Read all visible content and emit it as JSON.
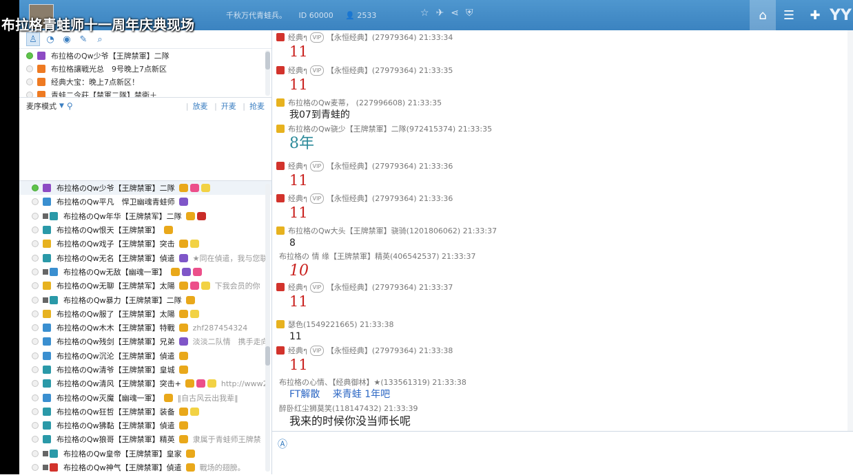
{
  "overlay_title": "布拉格青蛙师十一周年庆典现场",
  "header": {
    "slogan": "千秋万代青蛙兵。",
    "room_id": "ID 60000",
    "online_count": "2533",
    "icons": [
      "star-icon",
      "plane-icon",
      "share-icon",
      "shield-icon"
    ],
    "right_buttons": [
      "home-icon",
      "list-icon",
      "gamepad-icon"
    ],
    "brand": "YY"
  },
  "left_tabs": [
    "user-icon",
    "chat-bubble-icon",
    "location-icon",
    "edit-icon",
    "search-icon"
  ],
  "notices": [
    {
      "online": true,
      "gift": "purple",
      "text": "布拉格のQw少爷【王牌禁軍】二隊"
    },
    {
      "online": false,
      "gift": "orange",
      "text": "布拉格讓戦光总　9号晚上7点新区"
    },
    {
      "online": false,
      "gift": "orange",
      "text": "经典大宝：晚上7点新区！"
    },
    {
      "online": false,
      "gift": "orange",
      "text": "青蛙二今莊【禁軍二隊】禁衛＋"
    }
  ],
  "mic": {
    "mode_label": "麦序模式",
    "links": [
      "放麦",
      "开麦",
      "抢麦"
    ]
  },
  "users": [
    {
      "online": true,
      "cam": false,
      "name": "布拉格のQw少爷【王牌禁軍】二隊",
      "badges": [
        "crown",
        "pink",
        "yellow"
      ],
      "sig": ""
    },
    {
      "online": false,
      "cam": false,
      "name": "布拉格のQw平凡　悍卫幽魂青蛙师",
      "badges": [
        "purple"
      ],
      "sig": ""
    },
    {
      "online": false,
      "cam": true,
      "name": "布拉格のQw年华【王牌禁军】二隊",
      "badges": [
        "crown",
        "red"
      ],
      "sig": ""
    },
    {
      "online": false,
      "cam": false,
      "name": "布拉格のQw恨天【王牌禁軍】",
      "badges": [
        "crown"
      ],
      "sig": ""
    },
    {
      "online": false,
      "cam": false,
      "name": "布拉格のQw戏子【王牌禁軍】突击",
      "badges": [
        "crown",
        "yellow"
      ],
      "sig": ""
    },
    {
      "online": false,
      "cam": false,
      "name": "布拉格のQw无名【王牌禁軍】偵遣",
      "badges": [
        "purple"
      ],
      "sig": "★同在偵遣，我与您联"
    },
    {
      "online": false,
      "cam": true,
      "name": "布拉格のQw无敌【幽魂一軍】",
      "badges": [
        "crown",
        "purple",
        "pink"
      ],
      "sig": ""
    },
    {
      "online": false,
      "cam": false,
      "name": "布拉格のQw无聊【王牌禁军】太陽",
      "badges": [
        "crown",
        "pink",
        "yellow"
      ],
      "sig": "下我会员的你"
    },
    {
      "online": false,
      "cam": true,
      "name": "布拉格のQw暴力【王牌禁軍】二隊",
      "badges": [
        "crown"
      ],
      "sig": ""
    },
    {
      "online": false,
      "cam": false,
      "name": "布拉格のQw服了【王牌禁軍】太陽",
      "badges": [
        "crown",
        "yellow"
      ],
      "sig": ""
    },
    {
      "online": false,
      "cam": false,
      "name": "布拉格のQw木木【王牌禁軍】特戰",
      "badges": [
        "crown"
      ],
      "sig": "zhf287454324"
    },
    {
      "online": false,
      "cam": false,
      "name": "布拉格のQw残剑【王牌禁軍】兄弟",
      "badges": [
        "purple"
      ],
      "sig": "淡淡二队情　携手走向"
    },
    {
      "online": false,
      "cam": false,
      "name": "布拉格のQw沉沦【王牌禁軍】偵遣",
      "badges": [
        "crown"
      ],
      "sig": ""
    },
    {
      "online": false,
      "cam": false,
      "name": "布拉格のQw清爷【王牌禁軍】皇城",
      "badges": [
        "crown"
      ],
      "sig": ""
    },
    {
      "online": false,
      "cam": false,
      "name": "布拉格のQw清风【王牌禁軍】突击+",
      "badges": [
        "crown",
        "pink",
        "yellow"
      ],
      "sig": "http://www2"
    },
    {
      "online": false,
      "cam": false,
      "name": "布拉格のQw灭魔【幽魂一軍】",
      "badges": [
        "crown"
      ],
      "sig": "‖自古风云出我辈‖"
    },
    {
      "online": false,
      "cam": false,
      "name": "布拉格のQw狂哲【王牌禁軍】装备",
      "badges": [
        "crown",
        "yellow"
      ],
      "sig": ""
    },
    {
      "online": false,
      "cam": false,
      "name": "布拉格のQw狒黏【王牌禁軍】偵遣",
      "badges": [
        "crown"
      ],
      "sig": ""
    },
    {
      "online": false,
      "cam": false,
      "name": "布拉格のQw狼哥【王牌禁軍】精英",
      "badges": [
        "crown"
      ],
      "sig": "隶属于青蛙师王牌禁"
    },
    {
      "online": false,
      "cam": true,
      "name": "布拉格のQw皇帝【王牌禁軍】皇家",
      "badges": [
        "crown"
      ],
      "sig": ""
    },
    {
      "online": false,
      "cam": true,
      "name": "布拉格のQw神气【王牌禁軍】偵遣",
      "badges": [
        "crown"
      ],
      "sig": "戰场的翅膀。"
    }
  ],
  "messages": [
    {
      "rank": "red",
      "vip": true,
      "name": "经典ๆ",
      "tag": "【永恒经典】(27979364) 21:33:34",
      "text": "11",
      "style": "t-red"
    },
    {
      "rank": "red",
      "vip": true,
      "name": "经典ๆ",
      "tag": "【永恒经典】(27979364) 21:33:35",
      "text": "11",
      "style": "t-red"
    },
    {
      "rank": "gold",
      "vip": false,
      "name": "布拉格のQw麦蒂，",
      "tag": "(227996608) 21:33:35",
      "text": "我07到青蛙的",
      "style": "t-black"
    },
    {
      "rank": "gold",
      "vip": false,
      "name": "布拉格のQw骁少【王牌禁軍】二隊(972415374) 21:33:35",
      "tag": "",
      "text": "8年",
      "style": "t-teal"
    },
    {
      "rank": "red",
      "vip": true,
      "name": "经典ๆ",
      "tag": "【永恒经典】(27979364) 21:33:36",
      "text": "11",
      "style": "t-red"
    },
    {
      "rank": "red",
      "vip": true,
      "name": "经典ๆ",
      "tag": "【永恒经典】(27979364) 21:33:36",
      "text": "11",
      "style": "t-red"
    },
    {
      "rank": "gold",
      "vip": false,
      "name": "布拉格のQw大头【王牌禁軍】骁骑(1201806062) 21:33:37",
      "tag": "",
      "text": "8",
      "style": "t-black"
    },
    {
      "rank": "none",
      "vip": false,
      "name": "布拉格の 情 缘【王牌禁軍】精英(406542537) 21:33:37",
      "tag": "",
      "text": "10",
      "style": "t-red-italic"
    },
    {
      "rank": "red",
      "vip": true,
      "name": "经典ๆ",
      "tag": "【永恒经典】(27979364) 21:33:37",
      "text": "11",
      "style": "t-red"
    },
    {
      "rank": "gold",
      "vip": false,
      "name": "瑟色(1549221665) 21:33:38",
      "tag": "",
      "text": "11",
      "style": "t-black"
    },
    {
      "rank": "red",
      "vip": true,
      "name": "经典ๆ",
      "tag": "【永恒经典】(27979364) 21:33:38",
      "text": "11",
      "style": "t-red"
    },
    {
      "rank": "none",
      "vip": false,
      "name": "布拉格の心情、【经典御林】★(133561319) 21:33:38",
      "tag": "",
      "text": "FT解散　 来青蛙 1年吧",
      "style": "t-blue"
    },
    {
      "rank": "none",
      "vip": false,
      "name": "醉卧红尘狮莫笑(118147432) 21:33:39",
      "tag": "",
      "text": "我来的时候你没当师长呢",
      "style": "t-black-lg"
    }
  ]
}
